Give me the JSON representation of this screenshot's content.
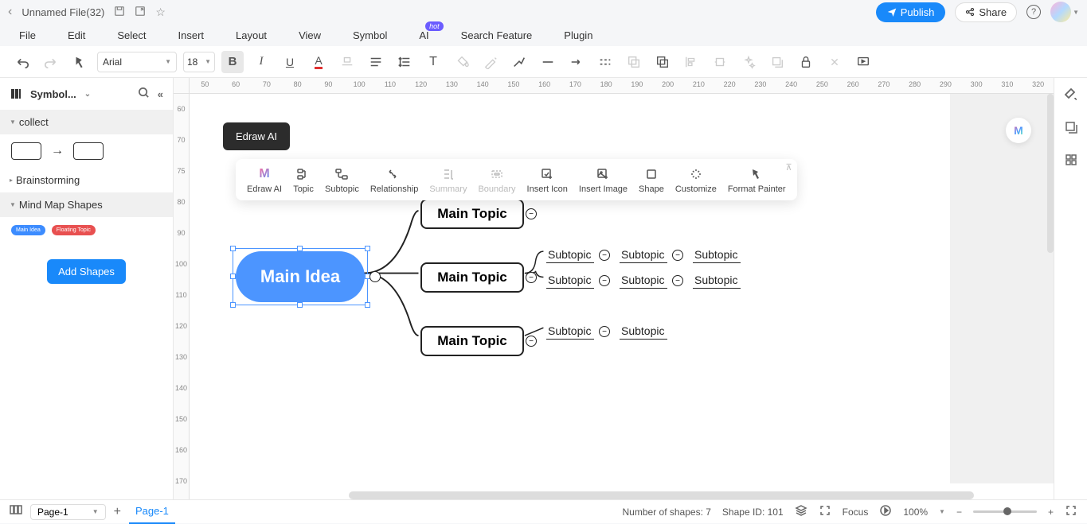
{
  "titleBar": {
    "filename": "Unnamed File(32)",
    "publish": "Publish",
    "share": "Share"
  },
  "menuBar": {
    "items": [
      "File",
      "Edit",
      "Select",
      "Insert",
      "Layout",
      "View",
      "Symbol",
      "AI",
      "Search Feature",
      "Plugin"
    ],
    "hotBadge": "hot",
    "hotIndex": 7
  },
  "toolbar": {
    "font": "Arial",
    "size": "18"
  },
  "leftPanel": {
    "title": "Symbol...",
    "sections": {
      "collect": "collect",
      "brainstorming": "Brainstorming",
      "mindMapShapes": "Mind Map Shapes"
    },
    "mmShapes": [
      "Main Idea",
      "Floating Topic"
    ],
    "addShapes": "Add Shapes"
  },
  "tooltip": "Edraw AI",
  "floatToolbar": {
    "items": [
      {
        "label": "Edraw AI",
        "disabled": false
      },
      {
        "label": "Topic",
        "disabled": false
      },
      {
        "label": "Subtopic",
        "disabled": false
      },
      {
        "label": "Relationship",
        "disabled": false
      },
      {
        "label": "Summary",
        "disabled": true
      },
      {
        "label": "Boundary",
        "disabled": true
      },
      {
        "label": "Insert Icon",
        "disabled": false
      },
      {
        "label": "Insert Image",
        "disabled": false
      },
      {
        "label": "Shape",
        "disabled": false
      },
      {
        "label": "Customize",
        "disabled": false
      },
      {
        "label": "Format Painter",
        "disabled": false
      }
    ]
  },
  "mindMap": {
    "mainIdea": "Main Idea",
    "mainTopics": [
      "Main Topic",
      "Main Topic",
      "Main Topic"
    ],
    "subtopics": {
      "row1": [
        "Subtopic",
        "Subtopic",
        "Subtopic"
      ],
      "row2": [
        "Subtopic",
        "Subtopic",
        "Subtopic"
      ],
      "row3": [
        "Subtopic",
        "Subtopic"
      ]
    }
  },
  "rulerH": [
    "50",
    "60",
    "70",
    "80",
    "90",
    "100",
    "110",
    "120",
    "130",
    "140",
    "150",
    "160",
    "170",
    "180",
    "190",
    "200",
    "210",
    "220",
    "230",
    "240",
    "250",
    "260",
    "270",
    "280",
    "290",
    "300",
    "310",
    "320"
  ],
  "rulerV": [
    "60",
    "70",
    "75",
    "80",
    "90",
    "100",
    "110",
    "120",
    "130",
    "140",
    "150",
    "160",
    "170"
  ],
  "bottomBar": {
    "pageDropdown": "Page-1",
    "pageTab": "Page-1",
    "shapesCount": "Number of shapes: 7",
    "shapeId": "Shape ID: 101",
    "focus": "Focus",
    "zoom": "100%"
  }
}
